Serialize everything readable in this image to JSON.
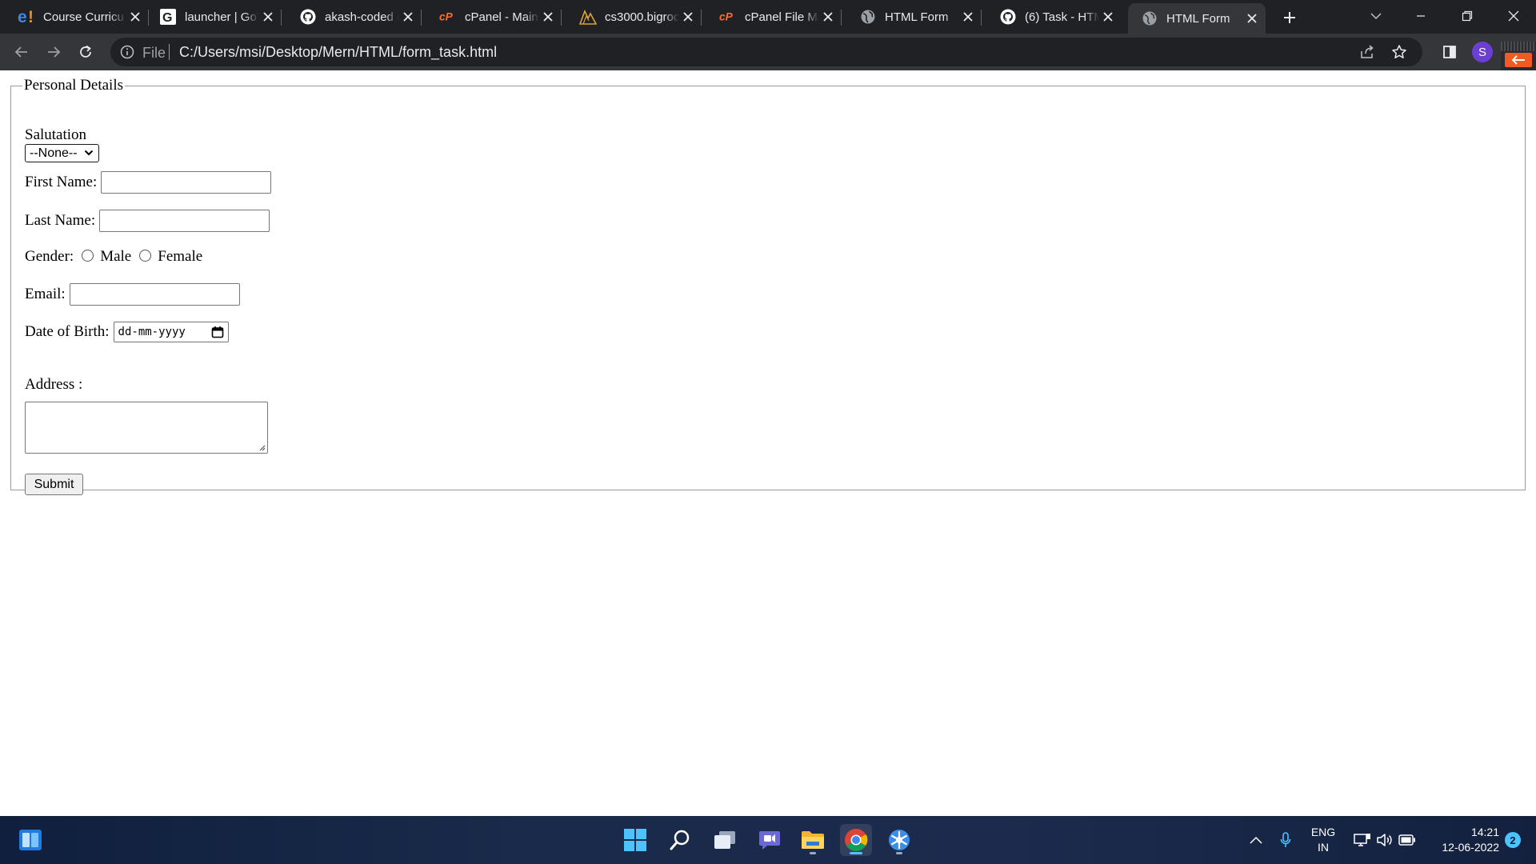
{
  "browser": {
    "tabs": [
      {
        "title": "Course Curricu",
        "icon": "edyoda-logo-icon"
      },
      {
        "title": "launcher | GoT",
        "icon": "g-logo-icon"
      },
      {
        "title": "akash-coded (",
        "icon": "github-icon"
      },
      {
        "title": "cPanel - Main",
        "icon": "cpanel-icon"
      },
      {
        "title": "cs3000.bigrock",
        "icon": "bigrock-icon"
      },
      {
        "title": "cPanel File Ma",
        "icon": "cpanel-icon"
      },
      {
        "title": "HTML Form",
        "icon": "globe-icon"
      },
      {
        "title": "(6) Task - HTM",
        "icon": "github-icon"
      },
      {
        "title": "HTML Form",
        "icon": "globe-icon",
        "active": true
      }
    ],
    "address_bar": {
      "scheme_label": "File",
      "url": "C:/Users/msi/Desktop/Mern/HTML/form_task.html"
    },
    "profile_initial": "S",
    "profile_color": "#6b3fd4"
  },
  "form": {
    "legend": "Personal Details",
    "salutation_label": "Salutation",
    "salutation_selected": "--None--",
    "first_name_label": "First Name:",
    "first_name_value": "",
    "last_name_label": "Last Name:",
    "last_name_value": "",
    "gender_label": "Gender:",
    "gender_options": [
      "Male",
      "Female"
    ],
    "email_label": "Email:",
    "email_value": "",
    "dob_label": "Date of Birth:",
    "dob_placeholder": "dd-mm-yyyy",
    "address_label": "Address :",
    "address_value": "",
    "submit_label": "Submit"
  },
  "taskbar": {
    "language": "ENG",
    "region": "IN",
    "time": "14:21",
    "date": "12-06-2022",
    "notification_count": "2",
    "accent_color": "#4cc2ff"
  }
}
